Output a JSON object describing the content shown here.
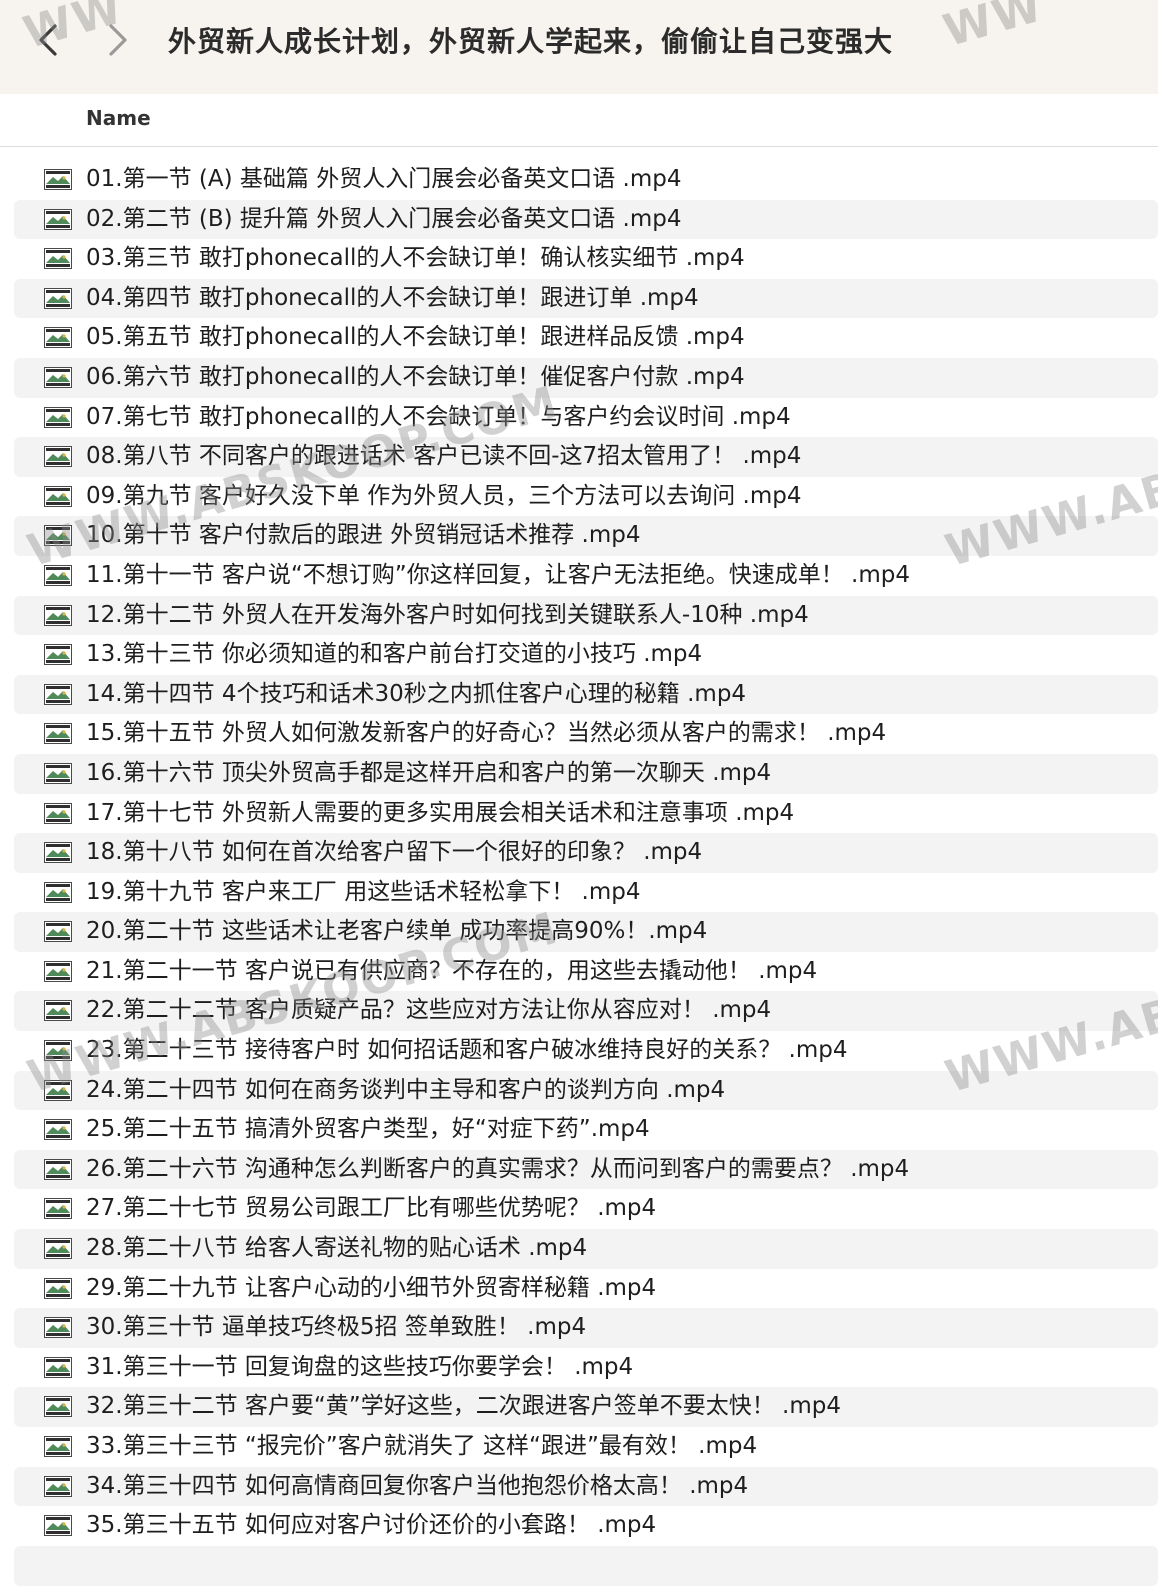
{
  "window": {
    "title": "外贸新人成长计划，外贸新人学起来，偷偷让自己变强大",
    "back_icon": "chevron-left-icon",
    "forward_icon": "chevron-right-icon"
  },
  "columns": {
    "name": "Name"
  },
  "file_icon": "video-file-icon",
  "files": [
    "01.第一节 (A) 基础篇 外贸人入门展会必备英文口语 .mp4",
    "02.第二节 (B) 提升篇 外贸人入门展会必备英文口语 .mp4",
    "03.第三节 敢打phonecall的人不会缺订单！确认核实细节 .mp4",
    "04.第四节 敢打phonecall的人不会缺订单！跟进订单 .mp4",
    "05.第五节 敢打phonecall的人不会缺订单！跟进样品反馈 .mp4",
    "06.第六节 敢打phonecall的人不会缺订单！催促客户付款 .mp4",
    "07.第七节 敢打phonecall的人不会缺订单！与客户约会议时间 .mp4",
    "08.第八节 不同客户的跟进话术 客户已读不回-这7招太管用了！ .mp4",
    "09.第九节 客户好久没下单 作为外贸人员，三个方法可以去询问 .mp4",
    "10.第十节 客户付款后的跟进 外贸销冠话术推荐 .mp4",
    "11.第十一节 客户说“不想订购”你这样回复，让客户无法拒绝。快速成单！ .mp4",
    "12.第十二节 外贸人在开发海外客户时如何找到关键联系人-10种 .mp4",
    "13.第十三节 你必须知道的和客户前台打交道的小技巧 .mp4",
    "14.第十四节 4个技巧和话术30秒之内抓住客户心理的秘籍 .mp4",
    "15.第十五节 外贸人如何激发新客户的好奇心？当然必须从客户的需求！ .mp4",
    "16.第十六节 顶尖外贸高手都是这样开启和客户的第一次聊天 .mp4",
    "17.第十七节 外贸新人需要的更多实用展会相关话术和注意事项 .mp4",
    "18.第十八节 如何在首次给客户留下一个很好的印象？ .mp4",
    "19.第十九节 客户来工厂 用这些话术轻松拿下！ .mp4",
    "20.第二十节 这些话术让老客户续单 成功率提高90%！.mp4",
    "21.第二十一节 客户说已有供应商？不存在的，用这些去撬动他！ .mp4",
    "22.第二十二节 客户质疑产品？这些应对方法让你从容应对！ .mp4",
    "23.第二十三节 接待客户时 如何招话题和客户破冰维持良好的关系？ .mp4",
    "24.第二十四节 如何在商务谈判中主导和客户的谈判方向 .mp4",
    "25.第二十五节 搞清外贸客户类型，好“对症下药”.mp4",
    "26.第二十六节 沟通种怎么判断客户的真实需求？从而问到客户的需要点？ .mp4",
    "27.第二十七节 贸易公司跟工厂比有哪些优势呢？ .mp4",
    "28.第二十八节 给客人寄送礼物的贴心话术 .mp4",
    "29.第二十九节 让客户心动的小细节外贸寄样秘籍 .mp4",
    "30.第三十节 逼单技巧终极5招 签单致胜！ .mp4",
    "31.第三十一节 回复询盘的这些技巧你要学会！ .mp4",
    "32.第三十二节 客户要“黄”学好这些，二次跟进客户签单不要太快！ .mp4",
    "33.第三十三节 “报完价”客户就消失了 这样“跟进”最有效！ .mp4",
    "34.第三十四节 如何高情商回复你客户当他抱怨价格太高！ .mp4",
    "35.第三十五节 如何应对客户讨价还价的小套路！ .mp4"
  ],
  "watermarks": [
    "WWW.ABSKOOP.COM",
    "WWW.ABS",
    "WWW.ABSKOOP.COM",
    "WWW.ABS",
    "WW",
    "WW"
  ]
}
